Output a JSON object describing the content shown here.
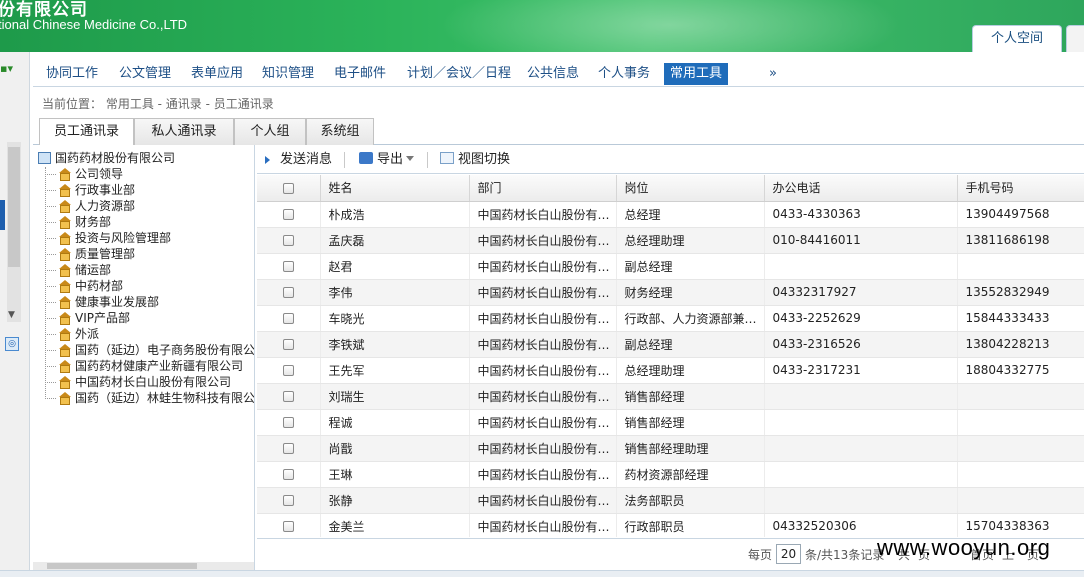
{
  "banner": {
    "company_cn": "份有限公司",
    "company_en": "tional Chinese Medicine Co.,LTD",
    "space_tab": "个人空间"
  },
  "nav": {
    "items": [
      "协同工作",
      "公文管理",
      "表单应用",
      "知识管理",
      "电子邮件",
      "计划／会议／日程",
      "公共信息",
      "个人事务",
      "常用工具"
    ],
    "active": "常用工具",
    "more": "»"
  },
  "breadcrumb": "当前位置： 常用工具 - 通讯录 - 员工通讯录",
  "tabs": [
    "员工通讯录",
    "私人通讯录",
    "个人组",
    "系统组"
  ],
  "tree": {
    "root": "国药药材股份有限公司",
    "nodes": [
      "公司领导",
      "行政事业部",
      "人力资源部",
      "财务部",
      "投资与风险管理部",
      "质量管理部",
      "储运部",
      "中药材部",
      "健康事业发展部",
      "VIP产品部",
      "外派",
      "国药（延边）电子商务股份有限公",
      "国药药材健康产业新疆有限公司",
      "中国药材长白山股份有限公司",
      "国药（延边）林蛙生物科技有限公"
    ]
  },
  "toolbar": {
    "send_message": "发送消息",
    "export": "导出",
    "switch_view": "视图切换"
  },
  "table": {
    "headers": [
      "姓名",
      "部门",
      "岗位",
      "办公电话",
      "手机号码"
    ],
    "rows": [
      [
        "朴成浩",
        "中国药材长白山股份有…",
        "总经理",
        "0433-4330363",
        "13904497568"
      ],
      [
        "孟庆磊",
        "中国药材长白山股份有…",
        "总经理助理",
        "010-84416011",
        "13811686198"
      ],
      [
        "赵君",
        "中国药材长白山股份有…",
        "副总经理",
        "",
        ""
      ],
      [
        "李伟",
        "中国药材长白山股份有…",
        "财务经理",
        "04332317927",
        "13552832949"
      ],
      [
        "车晓光",
        "中国药材长白山股份有…",
        "行政部、人力资源部兼…",
        "0433-2252629",
        "15844333433"
      ],
      [
        "李铁斌",
        "中国药材长白山股份有…",
        "副总经理",
        "0433-2316526",
        "13804228213"
      ],
      [
        "王先军",
        "中国药材长白山股份有…",
        "总经理助理",
        "0433-2317231",
        "18804332775"
      ],
      [
        "刘瑞生",
        "中国药材长白山股份有…",
        "销售部经理",
        "",
        ""
      ],
      [
        "程诚",
        "中国药材长白山股份有…",
        "销售部经理",
        "",
        ""
      ],
      [
        "尚戬",
        "中国药材长白山股份有…",
        "销售部经理助理",
        "",
        ""
      ],
      [
        "王琳",
        "中国药材长白山股份有…",
        "药材资源部经理",
        "",
        ""
      ],
      [
        "张静",
        "中国药材长白山股份有…",
        "法务部职员",
        "",
        ""
      ],
      [
        "金美兰",
        "中国药材长白山股份有…",
        "行政部职员",
        "04332520306",
        "15704338363"
      ]
    ]
  },
  "pager": {
    "per_page_label": "每页",
    "per_page_value": "20",
    "total_label": "条/共13条记录",
    "first": "共",
    "page_label": "页",
    "prev": "首页",
    "prev2": "上",
    "last": "页"
  },
  "watermark": "www.wooyun.org"
}
